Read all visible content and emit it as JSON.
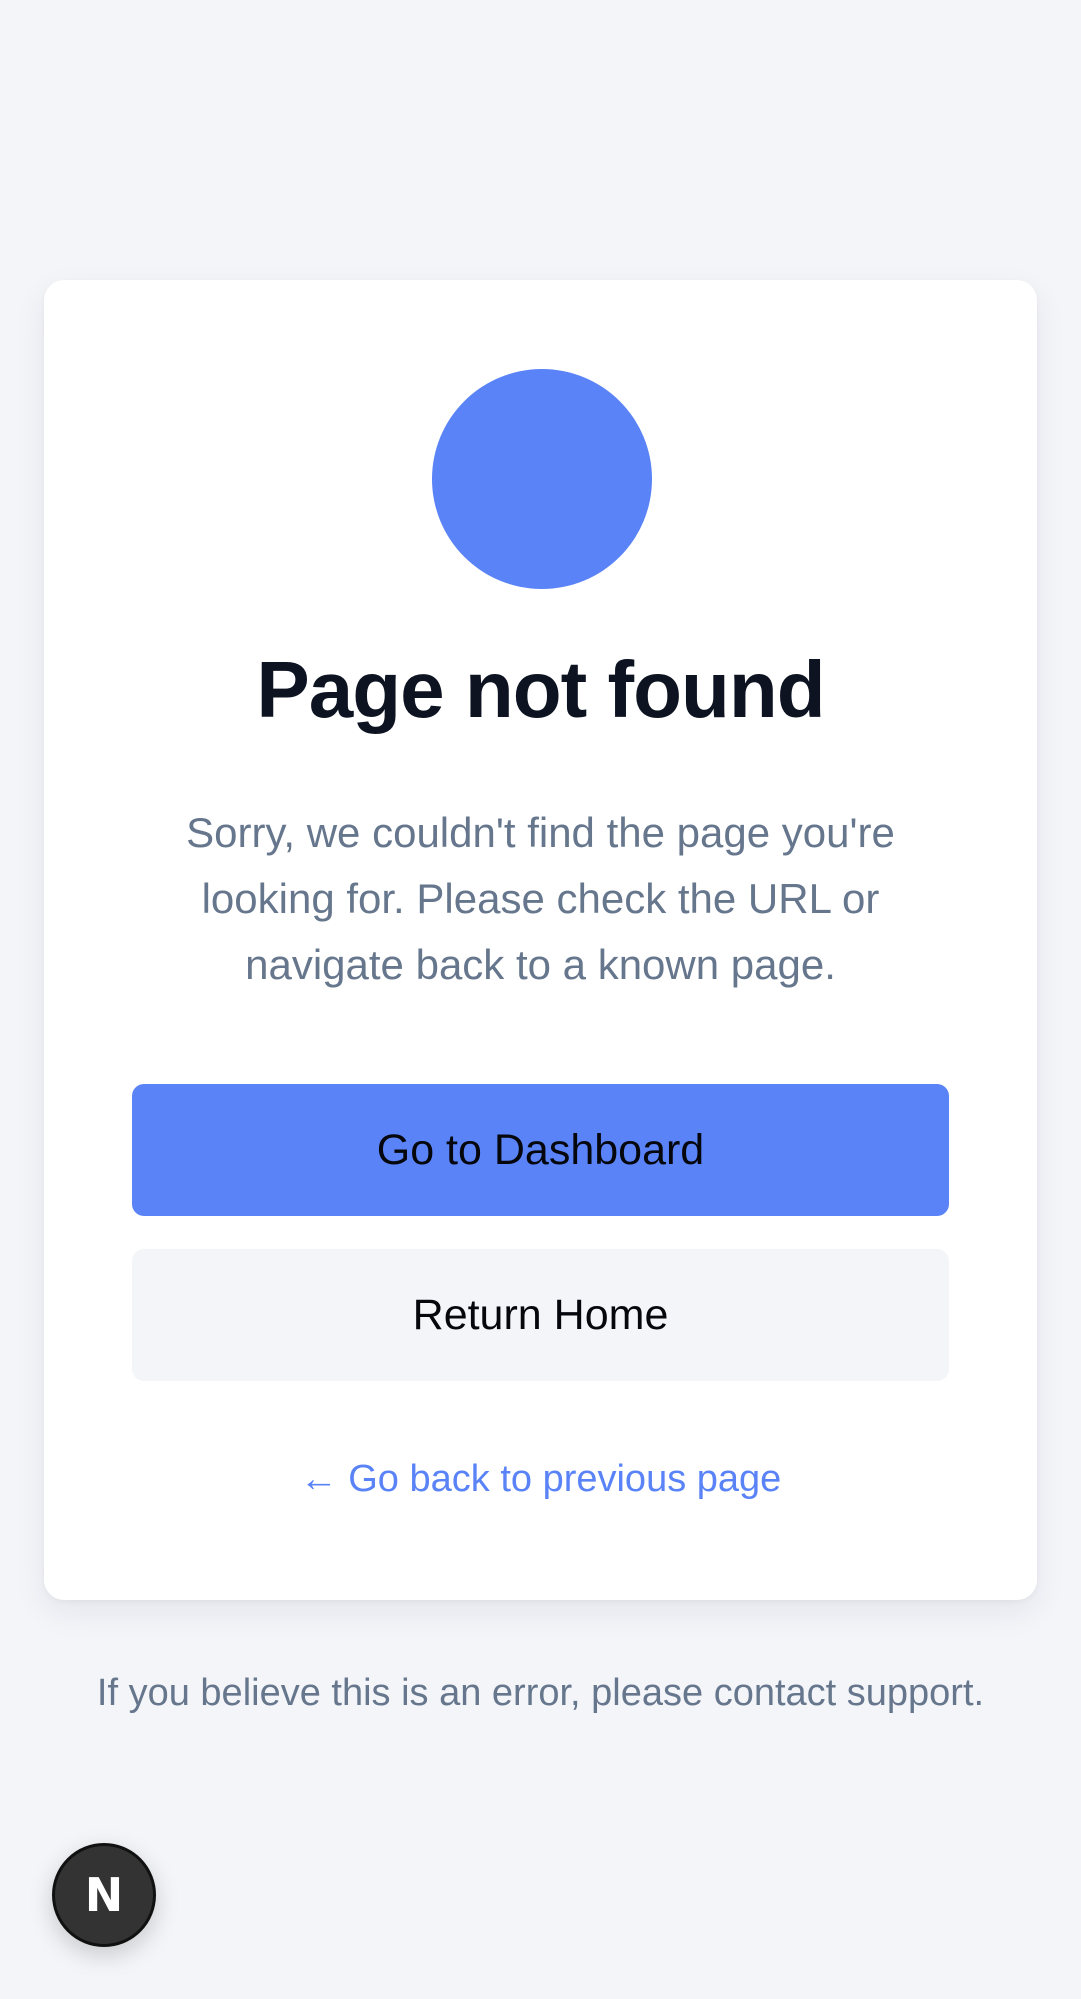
{
  "colors": {
    "background": "#f4f5f9",
    "card": "#ffffff",
    "accent": "#5983f7",
    "title": "#0d1321",
    "muted": "#66768c",
    "secondary_button": "#f4f5f9"
  },
  "card": {
    "icon": "blue-circle-icon",
    "title": "Page not found",
    "message": "Sorry, we couldn't find the page you're looking for. Please check the URL or navigate back to a known page.",
    "primary_button": "Go to Dashboard",
    "secondary_button": "Return Home",
    "back_link": "← Go back to previous page"
  },
  "footer": {
    "note": "If you believe this is an error, please contact support."
  },
  "dev_badge": {
    "label": "N",
    "icon": "nextjs-logo-icon"
  }
}
